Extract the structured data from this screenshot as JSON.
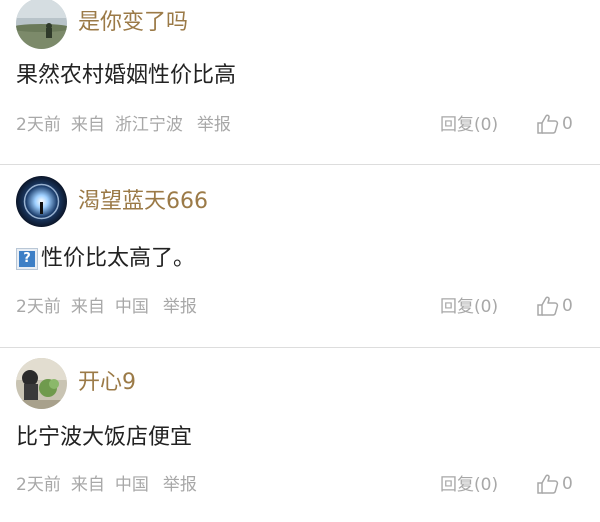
{
  "comments": [
    {
      "username": "是你变了吗",
      "text": "果然农村婚姻性价比高",
      "time": "2天前",
      "from": "来自",
      "location": "浙江宁波",
      "report": "举报",
      "reply": "回复(0)",
      "likes": "0"
    },
    {
      "username": "渴望蓝天666",
      "text": "性价比太高了。",
      "time": "2天前",
      "from": "来自",
      "location": "中国",
      "report": "举报",
      "reply": "回复(0)",
      "likes": "0"
    },
    {
      "username": "开心9",
      "text": "比宁波大饭店便宜",
      "time": "2天前",
      "from": "来自",
      "location": "中国",
      "report": "举报",
      "reply": "回复(0)",
      "likes": "0"
    }
  ],
  "icons": {
    "like": "thumbs-up-icon",
    "inline_image": "broken-image-icon"
  },
  "colors": {
    "username": "#9b7a47",
    "text": "#222222",
    "meta": "#a8a8a8",
    "divider": "#dddddd"
  }
}
